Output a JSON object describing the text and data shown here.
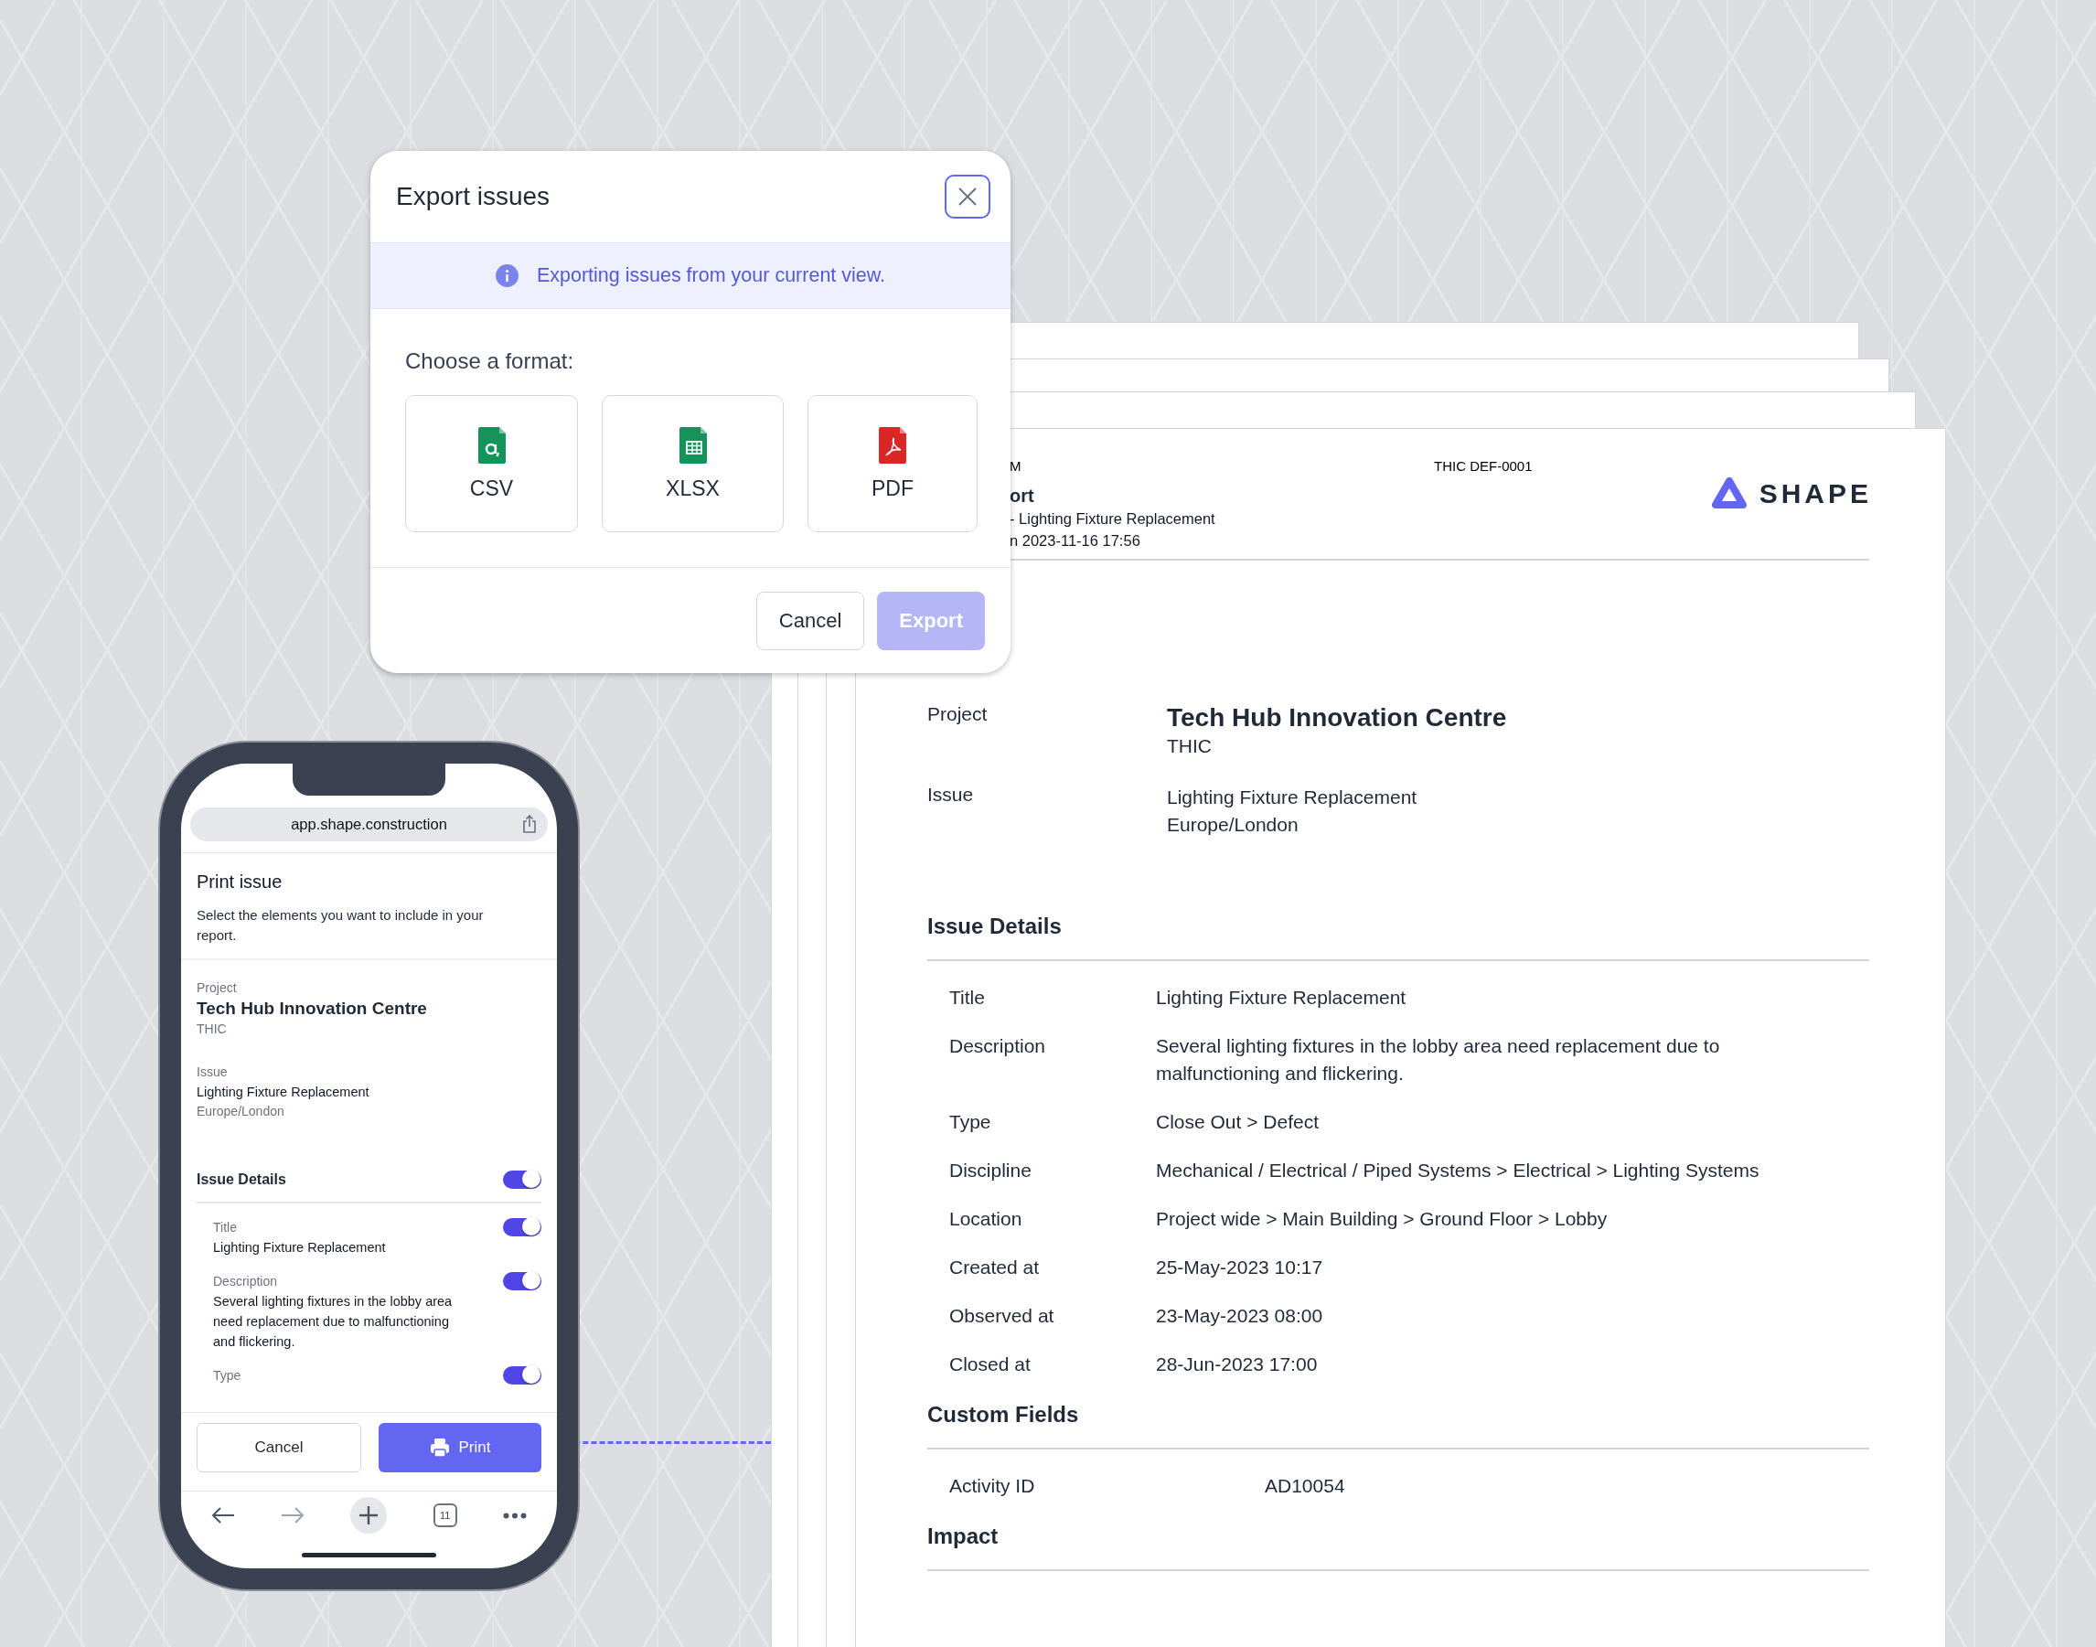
{
  "export_dialog": {
    "title": "Export issues",
    "info": "Exporting issues from your current view.",
    "prompt": "Choose a format:",
    "formats": [
      {
        "label": "CSV",
        "kind": "csv"
      },
      {
        "label": "XLSX",
        "kind": "xlsx"
      },
      {
        "label": "PDF",
        "kind": "pdf"
      }
    ],
    "buttons": [
      {
        "label": "Cancel",
        "kind": "secondary",
        "disabled": false
      },
      {
        "label": "Export",
        "kind": "primary",
        "disabled": true
      }
    ]
  },
  "phone": {
    "url": "app.shape.construction",
    "title": "Print issue",
    "description": "Select the elements you want to include in your report.",
    "project": {
      "label": "Project",
      "name": "Tech Hub Innovation Centre",
      "code": "THIC"
    },
    "issue": {
      "label": "Issue",
      "name": "Lighting Fixture Replacement",
      "timezone": "Europe/London"
    },
    "section": {
      "title": "Issue Details",
      "on": true
    },
    "fields": [
      {
        "label": "Title",
        "value": "Lighting Fixture Replacement",
        "on": true
      },
      {
        "label": "Description",
        "value": "Several lighting fixtures in the lobby area need replacement due to malfunctioning and flickering.",
        "on": true
      },
      {
        "label": "Type",
        "on": true
      }
    ],
    "buttons": [
      {
        "label": "Cancel",
        "kind": "secondary"
      },
      {
        "label": "Print",
        "kind": "primary"
      }
    ],
    "tab_count": "11"
  },
  "report": {
    "header": {
      "line_1": "M",
      "doc_id": "THIC DEF-0001",
      "title": "ort",
      "subtitle": "- Lighting Fixture Replacement",
      "generated": "n 2023-11-16 17:56",
      "logo": "SHAPE"
    },
    "project": {
      "label": "Project",
      "name": "Tech Hub Innovation Centre",
      "code": "THIC"
    },
    "issue": {
      "label": "Issue",
      "name": "Lighting Fixture Replacement",
      "timezone": "Europe/London"
    },
    "sections": [
      {
        "title": "Issue Details",
        "kind": "details",
        "rows": [
          {
            "label": "Title",
            "value": "Lighting Fixture Replacement"
          },
          {
            "label": "Description",
            "value": "Several lighting fixtures in the lobby area need replacement due to malfunctioning and flickering."
          },
          {
            "label": "Type",
            "value": "Close Out > Defect"
          },
          {
            "label": "Discipline",
            "value": "Mechanical / Electrical / Piped Systems > Electrical > Lighting Systems"
          },
          {
            "label": "Location",
            "value": "Project wide > Main Building > Ground Floor > Lobby"
          },
          {
            "label": "Created at",
            "value": "25-May-2023 10:17"
          },
          {
            "label": "Observed at",
            "value": "23-May-2023 08:00"
          },
          {
            "label": "Closed at",
            "value": "28-Jun-2023 17:00"
          }
        ]
      },
      {
        "title": "Custom Fields",
        "kind": "custom",
        "rows": [
          {
            "label": "Activity ID",
            "value": "AD10054"
          }
        ]
      },
      {
        "title": "Impact",
        "kind": "details"
      }
    ]
  }
}
